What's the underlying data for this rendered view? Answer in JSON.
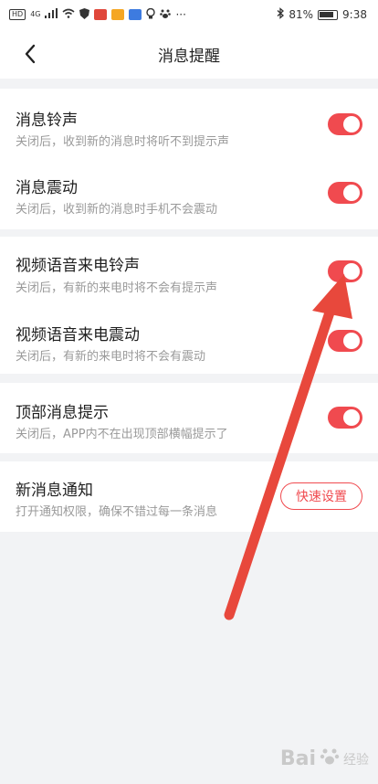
{
  "status_bar": {
    "left_icons": [
      "HD",
      "4G"
    ],
    "battery_percent": "81%",
    "time": "9:38",
    "more": "···"
  },
  "nav": {
    "title": "消息提醒",
    "back_icon": "chevron-left-icon"
  },
  "settings": [
    {
      "title": "消息铃声",
      "subtitle": "关闭后，收到新的消息时将听不到提示声",
      "enabled": true
    },
    {
      "title": "消息震动",
      "subtitle": "关闭后，收到新的消息时手机不会震动",
      "enabled": true
    },
    {
      "title": "视频语音来电铃声",
      "subtitle": "关闭后，有新的来电时将不会有提示声",
      "enabled": true
    },
    {
      "title": "视频语音来电震动",
      "subtitle": "关闭后，有新的来电时将不会有震动",
      "enabled": true
    },
    {
      "title": "顶部消息提示",
      "subtitle": "关闭后，APP内不在出现顶部横幅提示了",
      "enabled": true
    }
  ],
  "notification": {
    "title": "新消息通知",
    "subtitle": "打开通知权限，确保不错过每一条消息",
    "button_label": "快速设置"
  },
  "watermark": {
    "text": "Bai",
    "text_cn": "经验"
  },
  "colors": {
    "accent": "#f04a4f",
    "arrow": "#e8483c",
    "background": "#f2f3f5"
  }
}
